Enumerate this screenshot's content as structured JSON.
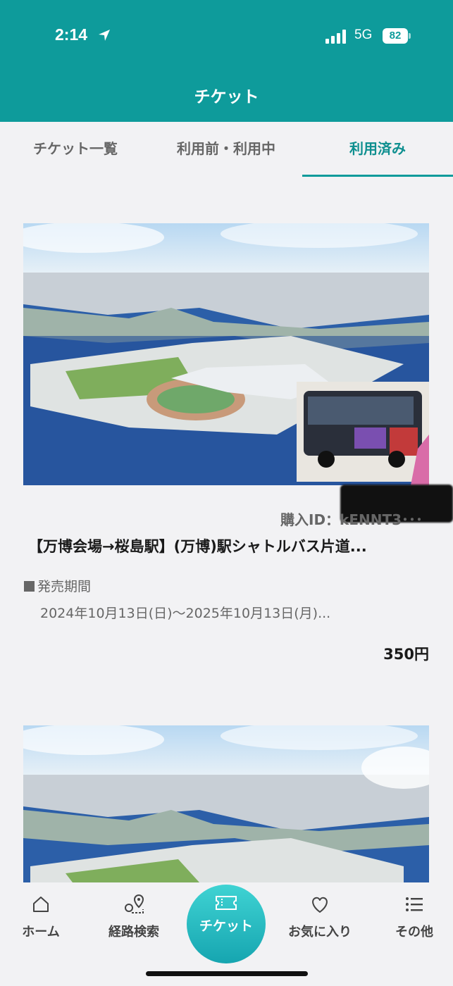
{
  "status_bar": {
    "time": "2:14",
    "network": "5G",
    "battery": "82"
  },
  "header": {
    "title": "チケット"
  },
  "tabs": [
    {
      "label": "チケット一覧",
      "active": false
    },
    {
      "label": "利用前・利用中",
      "active": false
    },
    {
      "label": "利用済み",
      "active": true
    }
  ],
  "tickets": [
    {
      "image_icon": "expo-site-aerial-photo",
      "purchase_id": "購入ID：kENNT3･･･",
      "title": "【万博会場→桜島駅】(万博)駅シャトルバス片道...",
      "sale_period_label": "発売期間",
      "sale_period": "2024年10月13日(日)～2025年10月13日(月)...",
      "price": "350円"
    },
    {
      "image_icon": "expo-site-aerial-photo"
    }
  ],
  "bottom_nav": {
    "home": "ホーム",
    "route": "経路検索",
    "ticket": "チケット",
    "favorites": "お気に入り",
    "other": "その他"
  },
  "colors": {
    "primary": "#0e9b9b",
    "background": "#f2f2f4"
  }
}
